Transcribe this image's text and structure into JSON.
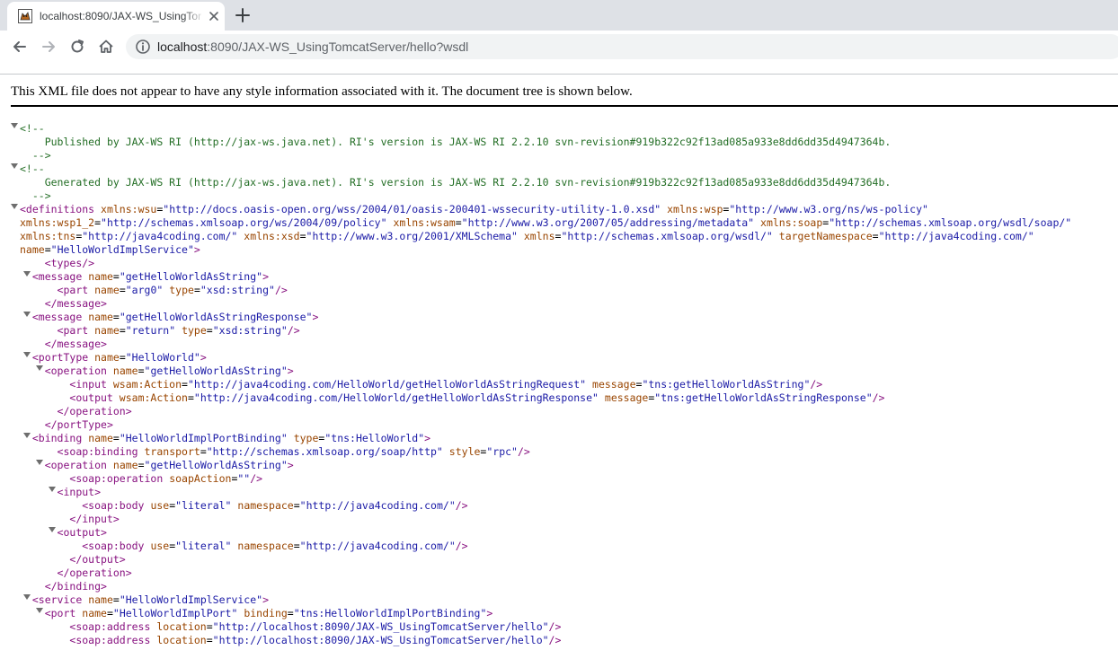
{
  "browser": {
    "tab_title": "localhost:8090/JAX-WS_UsingTomcatServer/hello?wsdl",
    "url_host": "localhost",
    "url_rest": ":8090/JAX-WS_UsingTomcatServer/hello?wsdl"
  },
  "xml_viewer": {
    "info_message": "This XML file does not appear to have any style information associated with it. The document tree is shown below.",
    "lines": [
      {
        "indent": 0,
        "toggle": true,
        "parts": [
          {
            "c": "cm",
            "t": "<!--"
          }
        ]
      },
      {
        "indent": 2,
        "toggle": false,
        "parts": [
          {
            "c": "cm",
            "t": "Published by JAX-WS RI (http://jax-ws.java.net). RI's version is JAX-WS RI 2.2.10 svn-revision#919b322c92f13ad085a933e8dd6dd35d4947364b."
          }
        ]
      },
      {
        "indent": 1,
        "toggle": false,
        "parts": [
          {
            "c": "cm",
            "t": "-->"
          }
        ]
      },
      {
        "indent": 0,
        "toggle": true,
        "parts": [
          {
            "c": "cm",
            "t": "<!--"
          }
        ]
      },
      {
        "indent": 2,
        "toggle": false,
        "parts": [
          {
            "c": "cm",
            "t": "Generated by JAX-WS RI (http://jax-ws.java.net). RI's version is JAX-WS RI 2.2.10 svn-revision#919b322c92f13ad085a933e8dd6dd35d4947364b."
          }
        ]
      },
      {
        "indent": 1,
        "toggle": false,
        "parts": [
          {
            "c": "cm",
            "t": "-->"
          }
        ]
      },
      {
        "indent": 0,
        "toggle": true,
        "parts": [
          {
            "c": "tag",
            "t": "<definitions"
          },
          {
            "c": "pn",
            "t": " "
          },
          {
            "c": "an",
            "t": "xmlns:wsu"
          },
          {
            "c": "pn",
            "t": "="
          },
          {
            "c": "av",
            "t": "\"http://docs.oasis-open.org/wss/2004/01/oasis-200401-wssecurity-utility-1.0.xsd\""
          },
          {
            "c": "pn",
            "t": " "
          },
          {
            "c": "an",
            "t": "xmlns:wsp"
          },
          {
            "c": "pn",
            "t": "="
          },
          {
            "c": "av",
            "t": "\"http://www.w3.org/ns/ws-policy\""
          }
        ]
      },
      {
        "indent": 0,
        "toggle": false,
        "parts": [
          {
            "c": "an",
            "t": "xmlns:wsp1_2"
          },
          {
            "c": "pn",
            "t": "="
          },
          {
            "c": "av",
            "t": "\"http://schemas.xmlsoap.org/ws/2004/09/policy\""
          },
          {
            "c": "pn",
            "t": " "
          },
          {
            "c": "an",
            "t": "xmlns:wsam"
          },
          {
            "c": "pn",
            "t": "="
          },
          {
            "c": "av",
            "t": "\"http://www.w3.org/2007/05/addressing/metadata\""
          },
          {
            "c": "pn",
            "t": " "
          },
          {
            "c": "an",
            "t": "xmlns:soap"
          },
          {
            "c": "pn",
            "t": "="
          },
          {
            "c": "av",
            "t": "\"http://schemas.xmlsoap.org/wsdl/soap/\""
          }
        ]
      },
      {
        "indent": 0,
        "toggle": false,
        "parts": [
          {
            "c": "an",
            "t": "xmlns:tns"
          },
          {
            "c": "pn",
            "t": "="
          },
          {
            "c": "av",
            "t": "\"http://java4coding.com/\""
          },
          {
            "c": "pn",
            "t": " "
          },
          {
            "c": "an",
            "t": "xmlns:xsd"
          },
          {
            "c": "pn",
            "t": "="
          },
          {
            "c": "av",
            "t": "\"http://www.w3.org/2001/XMLSchema\""
          },
          {
            "c": "pn",
            "t": " "
          },
          {
            "c": "an",
            "t": "xmlns"
          },
          {
            "c": "pn",
            "t": "="
          },
          {
            "c": "av",
            "t": "\"http://schemas.xmlsoap.org/wsdl/\""
          },
          {
            "c": "pn",
            "t": " "
          },
          {
            "c": "an",
            "t": "targetNamespace"
          },
          {
            "c": "pn",
            "t": "="
          },
          {
            "c": "av",
            "t": "\"http://java4coding.com/\""
          }
        ]
      },
      {
        "indent": 0,
        "toggle": false,
        "parts": [
          {
            "c": "an",
            "t": "name"
          },
          {
            "c": "pn",
            "t": "="
          },
          {
            "c": "av",
            "t": "\"HelloWorldImplService\""
          },
          {
            "c": "tag",
            "t": ">"
          }
        ]
      },
      {
        "indent": 2,
        "toggle": false,
        "parts": [
          {
            "c": "tag",
            "t": "<types/>"
          }
        ]
      },
      {
        "indent": 1,
        "toggle": true,
        "parts": [
          {
            "c": "tag",
            "t": "<message"
          },
          {
            "c": "pn",
            "t": " "
          },
          {
            "c": "an",
            "t": "name"
          },
          {
            "c": "pn",
            "t": "="
          },
          {
            "c": "av",
            "t": "\"getHelloWorldAsString\""
          },
          {
            "c": "tag",
            "t": ">"
          }
        ]
      },
      {
        "indent": 3,
        "toggle": false,
        "parts": [
          {
            "c": "tag",
            "t": "<part"
          },
          {
            "c": "pn",
            "t": " "
          },
          {
            "c": "an",
            "t": "name"
          },
          {
            "c": "pn",
            "t": "="
          },
          {
            "c": "av",
            "t": "\"arg0\""
          },
          {
            "c": "pn",
            "t": " "
          },
          {
            "c": "an",
            "t": "type"
          },
          {
            "c": "pn",
            "t": "="
          },
          {
            "c": "av",
            "t": "\"xsd:string\""
          },
          {
            "c": "tag",
            "t": "/>"
          }
        ]
      },
      {
        "indent": 2,
        "toggle": false,
        "parts": [
          {
            "c": "tag",
            "t": "</message>"
          }
        ]
      },
      {
        "indent": 1,
        "toggle": true,
        "parts": [
          {
            "c": "tag",
            "t": "<message"
          },
          {
            "c": "pn",
            "t": " "
          },
          {
            "c": "an",
            "t": "name"
          },
          {
            "c": "pn",
            "t": "="
          },
          {
            "c": "av",
            "t": "\"getHelloWorldAsStringResponse\""
          },
          {
            "c": "tag",
            "t": ">"
          }
        ]
      },
      {
        "indent": 3,
        "toggle": false,
        "parts": [
          {
            "c": "tag",
            "t": "<part"
          },
          {
            "c": "pn",
            "t": " "
          },
          {
            "c": "an",
            "t": "name"
          },
          {
            "c": "pn",
            "t": "="
          },
          {
            "c": "av",
            "t": "\"return\""
          },
          {
            "c": "pn",
            "t": " "
          },
          {
            "c": "an",
            "t": "type"
          },
          {
            "c": "pn",
            "t": "="
          },
          {
            "c": "av",
            "t": "\"xsd:string\""
          },
          {
            "c": "tag",
            "t": "/>"
          }
        ]
      },
      {
        "indent": 2,
        "toggle": false,
        "parts": [
          {
            "c": "tag",
            "t": "</message>"
          }
        ]
      },
      {
        "indent": 1,
        "toggle": true,
        "parts": [
          {
            "c": "tag",
            "t": "<portType"
          },
          {
            "c": "pn",
            "t": " "
          },
          {
            "c": "an",
            "t": "name"
          },
          {
            "c": "pn",
            "t": "="
          },
          {
            "c": "av",
            "t": "\"HelloWorld\""
          },
          {
            "c": "tag",
            "t": ">"
          }
        ]
      },
      {
        "indent": 2,
        "toggle": true,
        "parts": [
          {
            "c": "tag",
            "t": "<operation"
          },
          {
            "c": "pn",
            "t": " "
          },
          {
            "c": "an",
            "t": "name"
          },
          {
            "c": "pn",
            "t": "="
          },
          {
            "c": "av",
            "t": "\"getHelloWorldAsString\""
          },
          {
            "c": "tag",
            "t": ">"
          }
        ]
      },
      {
        "indent": 4,
        "toggle": false,
        "parts": [
          {
            "c": "tag",
            "t": "<input"
          },
          {
            "c": "pn",
            "t": " "
          },
          {
            "c": "an",
            "t": "wsam:Action"
          },
          {
            "c": "pn",
            "t": "="
          },
          {
            "c": "av",
            "t": "\"http://java4coding.com/HelloWorld/getHelloWorldAsStringRequest\""
          },
          {
            "c": "pn",
            "t": " "
          },
          {
            "c": "an",
            "t": "message"
          },
          {
            "c": "pn",
            "t": "="
          },
          {
            "c": "av",
            "t": "\"tns:getHelloWorldAsString\""
          },
          {
            "c": "tag",
            "t": "/>"
          }
        ]
      },
      {
        "indent": 4,
        "toggle": false,
        "parts": [
          {
            "c": "tag",
            "t": "<output"
          },
          {
            "c": "pn",
            "t": " "
          },
          {
            "c": "an",
            "t": "wsam:Action"
          },
          {
            "c": "pn",
            "t": "="
          },
          {
            "c": "av",
            "t": "\"http://java4coding.com/HelloWorld/getHelloWorldAsStringResponse\""
          },
          {
            "c": "pn",
            "t": " "
          },
          {
            "c": "an",
            "t": "message"
          },
          {
            "c": "pn",
            "t": "="
          },
          {
            "c": "av",
            "t": "\"tns:getHelloWorldAsStringResponse\""
          },
          {
            "c": "tag",
            "t": "/>"
          }
        ]
      },
      {
        "indent": 3,
        "toggle": false,
        "parts": [
          {
            "c": "tag",
            "t": "</operation>"
          }
        ]
      },
      {
        "indent": 2,
        "toggle": false,
        "parts": [
          {
            "c": "tag",
            "t": "</portType>"
          }
        ]
      },
      {
        "indent": 1,
        "toggle": true,
        "parts": [
          {
            "c": "tag",
            "t": "<binding"
          },
          {
            "c": "pn",
            "t": " "
          },
          {
            "c": "an",
            "t": "name"
          },
          {
            "c": "pn",
            "t": "="
          },
          {
            "c": "av",
            "t": "\"HelloWorldImplPortBinding\""
          },
          {
            "c": "pn",
            "t": " "
          },
          {
            "c": "an",
            "t": "type"
          },
          {
            "c": "pn",
            "t": "="
          },
          {
            "c": "av",
            "t": "\"tns:HelloWorld\""
          },
          {
            "c": "tag",
            "t": ">"
          }
        ]
      },
      {
        "indent": 3,
        "toggle": false,
        "parts": [
          {
            "c": "tag",
            "t": "<soap:binding"
          },
          {
            "c": "pn",
            "t": " "
          },
          {
            "c": "an",
            "t": "transport"
          },
          {
            "c": "pn",
            "t": "="
          },
          {
            "c": "av",
            "t": "\"http://schemas.xmlsoap.org/soap/http\""
          },
          {
            "c": "pn",
            "t": " "
          },
          {
            "c": "an",
            "t": "style"
          },
          {
            "c": "pn",
            "t": "="
          },
          {
            "c": "av",
            "t": "\"rpc\""
          },
          {
            "c": "tag",
            "t": "/>"
          }
        ]
      },
      {
        "indent": 2,
        "toggle": true,
        "parts": [
          {
            "c": "tag",
            "t": "<operation"
          },
          {
            "c": "pn",
            "t": " "
          },
          {
            "c": "an",
            "t": "name"
          },
          {
            "c": "pn",
            "t": "="
          },
          {
            "c": "av",
            "t": "\"getHelloWorldAsString\""
          },
          {
            "c": "tag",
            "t": ">"
          }
        ]
      },
      {
        "indent": 4,
        "toggle": false,
        "parts": [
          {
            "c": "tag",
            "t": "<soap:operation"
          },
          {
            "c": "pn",
            "t": " "
          },
          {
            "c": "an",
            "t": "soapAction"
          },
          {
            "c": "pn",
            "t": "="
          },
          {
            "c": "av",
            "t": "\"\""
          },
          {
            "c": "tag",
            "t": "/>"
          }
        ]
      },
      {
        "indent": 3,
        "toggle": true,
        "parts": [
          {
            "c": "tag",
            "t": "<input>"
          }
        ]
      },
      {
        "indent": 5,
        "toggle": false,
        "parts": [
          {
            "c": "tag",
            "t": "<soap:body"
          },
          {
            "c": "pn",
            "t": " "
          },
          {
            "c": "an",
            "t": "use"
          },
          {
            "c": "pn",
            "t": "="
          },
          {
            "c": "av",
            "t": "\"literal\""
          },
          {
            "c": "pn",
            "t": " "
          },
          {
            "c": "an",
            "t": "namespace"
          },
          {
            "c": "pn",
            "t": "="
          },
          {
            "c": "av",
            "t": "\"http://java4coding.com/\""
          },
          {
            "c": "tag",
            "t": "/>"
          }
        ]
      },
      {
        "indent": 4,
        "toggle": false,
        "parts": [
          {
            "c": "tag",
            "t": "</input>"
          }
        ]
      },
      {
        "indent": 3,
        "toggle": true,
        "parts": [
          {
            "c": "tag",
            "t": "<output>"
          }
        ]
      },
      {
        "indent": 5,
        "toggle": false,
        "parts": [
          {
            "c": "tag",
            "t": "<soap:body"
          },
          {
            "c": "pn",
            "t": " "
          },
          {
            "c": "an",
            "t": "use"
          },
          {
            "c": "pn",
            "t": "="
          },
          {
            "c": "av",
            "t": "\"literal\""
          },
          {
            "c": "pn",
            "t": " "
          },
          {
            "c": "an",
            "t": "namespace"
          },
          {
            "c": "pn",
            "t": "="
          },
          {
            "c": "av",
            "t": "\"http://java4coding.com/\""
          },
          {
            "c": "tag",
            "t": "/>"
          }
        ]
      },
      {
        "indent": 4,
        "toggle": false,
        "parts": [
          {
            "c": "tag",
            "t": "</output>"
          }
        ]
      },
      {
        "indent": 3,
        "toggle": false,
        "parts": [
          {
            "c": "tag",
            "t": "</operation>"
          }
        ]
      },
      {
        "indent": 2,
        "toggle": false,
        "parts": [
          {
            "c": "tag",
            "t": "</binding>"
          }
        ]
      },
      {
        "indent": 1,
        "toggle": true,
        "parts": [
          {
            "c": "tag",
            "t": "<service"
          },
          {
            "c": "pn",
            "t": " "
          },
          {
            "c": "an",
            "t": "name"
          },
          {
            "c": "pn",
            "t": "="
          },
          {
            "c": "av",
            "t": "\"HelloWorldImplService\""
          },
          {
            "c": "tag",
            "t": ">"
          }
        ]
      },
      {
        "indent": 2,
        "toggle": true,
        "parts": [
          {
            "c": "tag",
            "t": "<port"
          },
          {
            "c": "pn",
            "t": " "
          },
          {
            "c": "an",
            "t": "name"
          },
          {
            "c": "pn",
            "t": "="
          },
          {
            "c": "av",
            "t": "\"HelloWorldImplPort\""
          },
          {
            "c": "pn",
            "t": " "
          },
          {
            "c": "an",
            "t": "binding"
          },
          {
            "c": "pn",
            "t": "="
          },
          {
            "c": "av",
            "t": "\"tns:HelloWorldImplPortBinding\""
          },
          {
            "c": "tag",
            "t": ">"
          }
        ]
      },
      {
        "indent": 4,
        "toggle": false,
        "parts": [
          {
            "c": "tag",
            "t": "<soap:address"
          },
          {
            "c": "pn",
            "t": " "
          },
          {
            "c": "an",
            "t": "location"
          },
          {
            "c": "pn",
            "t": "="
          },
          {
            "c": "av",
            "t": "\"http://localhost:8090/JAX-WS_UsingTomcatServer/hello\""
          },
          {
            "c": "tag",
            "t": "/>"
          }
        ]
      },
      {
        "indent": 4,
        "toggle": false,
        "parts": [
          {
            "c": "tag",
            "t": "<soap:address"
          },
          {
            "c": "pn",
            "t": " "
          },
          {
            "c": "an",
            "t": "location"
          },
          {
            "c": "pn",
            "t": "="
          },
          {
            "c": "av",
            "t": "\"http://localhost:8090/JAX-WS_UsingTomcatServer/hello\""
          },
          {
            "c": "tag",
            "t": "/>"
          }
        ]
      }
    ]
  }
}
